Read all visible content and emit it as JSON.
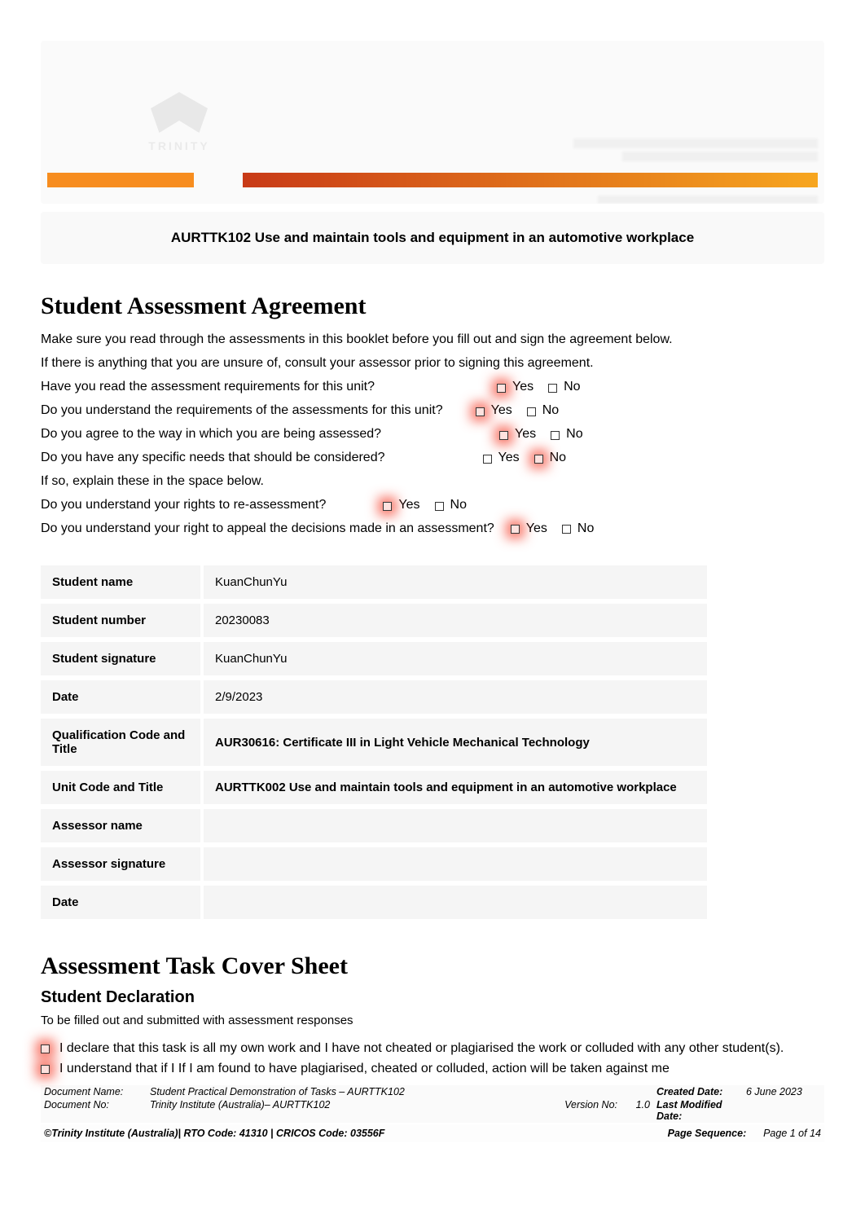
{
  "header": {
    "logo_text": "TRINITY",
    "unit_title": "AURTTK102 Use and maintain tools and equipment in an automotive workplace"
  },
  "section1": {
    "title": "Student Assessment Agreement",
    "intro1": "Make sure you read through the assessments in this booklet before you fill out and sign the agreement below.",
    "intro2": "If there is anything that you are unsure of, consult your assessor prior to signing this agreement.",
    "q1": "Have you read the assessment requirements for this unit?",
    "q2": "Do you understand the requirements of the assessments for this unit?",
    "q3": "Do you agree to the way in which you are being assessed?",
    "q4": "Do you have any specific needs that should be considered?",
    "q4_follow": "If so, explain these in the space below.",
    "q5": "Do you understand your rights to re-assessment?",
    "q6": "Do you understand your right to appeal the decisions made in an assessment?",
    "yes": "Yes",
    "no": "No"
  },
  "table": {
    "rows": [
      {
        "label": "Student name",
        "value": "KuanChunYu",
        "bold": false
      },
      {
        "label": "Student number",
        "value": "20230083",
        "bold": false
      },
      {
        "label": "Student signature",
        "value": "KuanChunYu",
        "bold": false
      },
      {
        "label": "Date",
        "value": "2/9/2023",
        "bold": false
      },
      {
        "label": "Qualification Code and Title",
        "value": "AUR30616: Certificate III in Light Vehicle Mechanical Technology",
        "bold": true
      },
      {
        "label": "Unit Code and Title",
        "value": "AURTTK002 Use and maintain tools and equipment in an automotive workplace",
        "bold": true
      },
      {
        "label": "Assessor name",
        "value": "",
        "bold": false
      },
      {
        "label": "Assessor signature",
        "value": "",
        "bold": false
      },
      {
        "label": "Date",
        "value": "",
        "bold": false
      }
    ]
  },
  "section2": {
    "title": "Assessment Task Cover Sheet",
    "subtitle": "Student Declaration",
    "instruction": "To be filled out and submitted with assessment responses",
    "d1": "I declare that this task is all my own work and I have not cheated or plagiarised the work or colluded with any other student(s).",
    "d2": "I understand that if I If I am found to have plagiarised, cheated or colluded, action will be taken against me"
  },
  "footer": {
    "doc_name_label": "Document Name:",
    "doc_name_value": "Student Practical Demonstration of Tasks – AURTTK102",
    "created_label": "Created Date:",
    "created_value": "6 June 2023",
    "doc_no_label": "Document No:",
    "doc_no_value": "Trinity Institute (Australia)– AURTTK102",
    "version_label": "Version No:",
    "version_value": "1.0",
    "modified_label": "Last Modified Date:",
    "copyright": "©Trinity Institute (Australia)| RTO Code: 41310 | CRICOS Code: 03556F",
    "page_seq_label": "Page Sequence:",
    "page_seq_value": "Page 1 of 14"
  }
}
